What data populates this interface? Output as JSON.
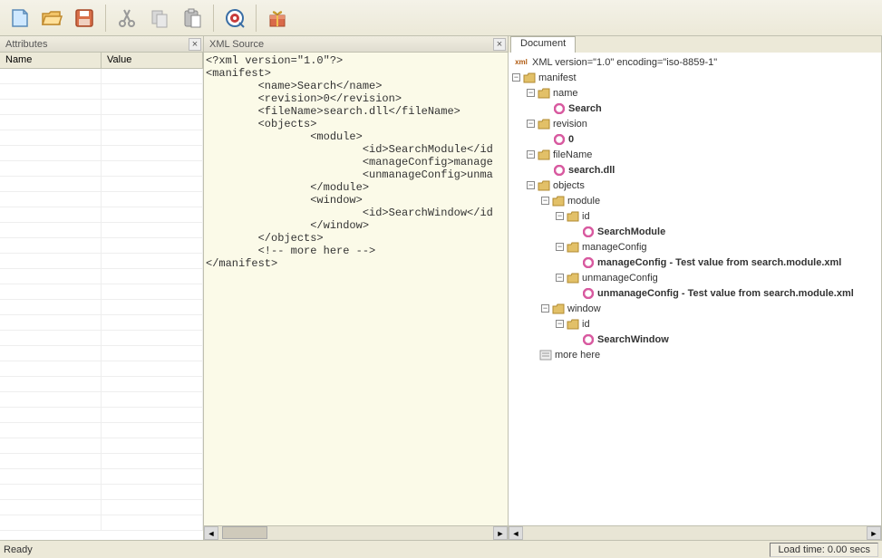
{
  "toolbar": {
    "icons": [
      "new",
      "open",
      "save",
      "cut",
      "copy",
      "paste",
      "target",
      "gift"
    ]
  },
  "panels": {
    "attributes": {
      "title": "Attributes",
      "col_name": "Name",
      "col_value": "Value"
    },
    "xml_source": {
      "title": "XML Source",
      "content": "<?xml version=\"1.0\"?>\n<manifest>\n        <name>Search</name>\n        <revision>0</revision>\n        <fileName>search.dll</fileName>\n        <objects>\n                <module>\n                        <id>SearchModule</id\n                        <manageConfig>manage\n                        <unmanageConfig>unma\n                </module>\n                <window>\n                        <id>SearchWindow</id\n                </window>\n        </objects>\n        <!-- more here -->\n</manifest>"
    },
    "document": {
      "title": "Document"
    }
  },
  "tree": {
    "decl": "XML version=\"1.0\" encoding=\"iso-8859-1\"",
    "root": "manifest",
    "name": {
      "label": "name",
      "value": "Search"
    },
    "revision": {
      "label": "revision",
      "value": "0"
    },
    "fileName": {
      "label": "fileName",
      "value": "search.dll"
    },
    "objects": {
      "label": "objects",
      "module": {
        "label": "module",
        "id": {
          "label": "id",
          "value": "SearchModule"
        },
        "manageConfig": {
          "label": "manageConfig",
          "value": "manageConfig - Test value from search.module.xml"
        },
        "unmanageConfig": {
          "label": "unmanageConfig",
          "value": "unmanageConfig - Test value from search.module.xml"
        }
      },
      "window": {
        "label": "window",
        "id": {
          "label": "id",
          "value": "SearchWindow"
        }
      }
    },
    "comment": "more here"
  },
  "statusbar": {
    "left": "Ready",
    "right": "Load time: 0.00 secs"
  }
}
